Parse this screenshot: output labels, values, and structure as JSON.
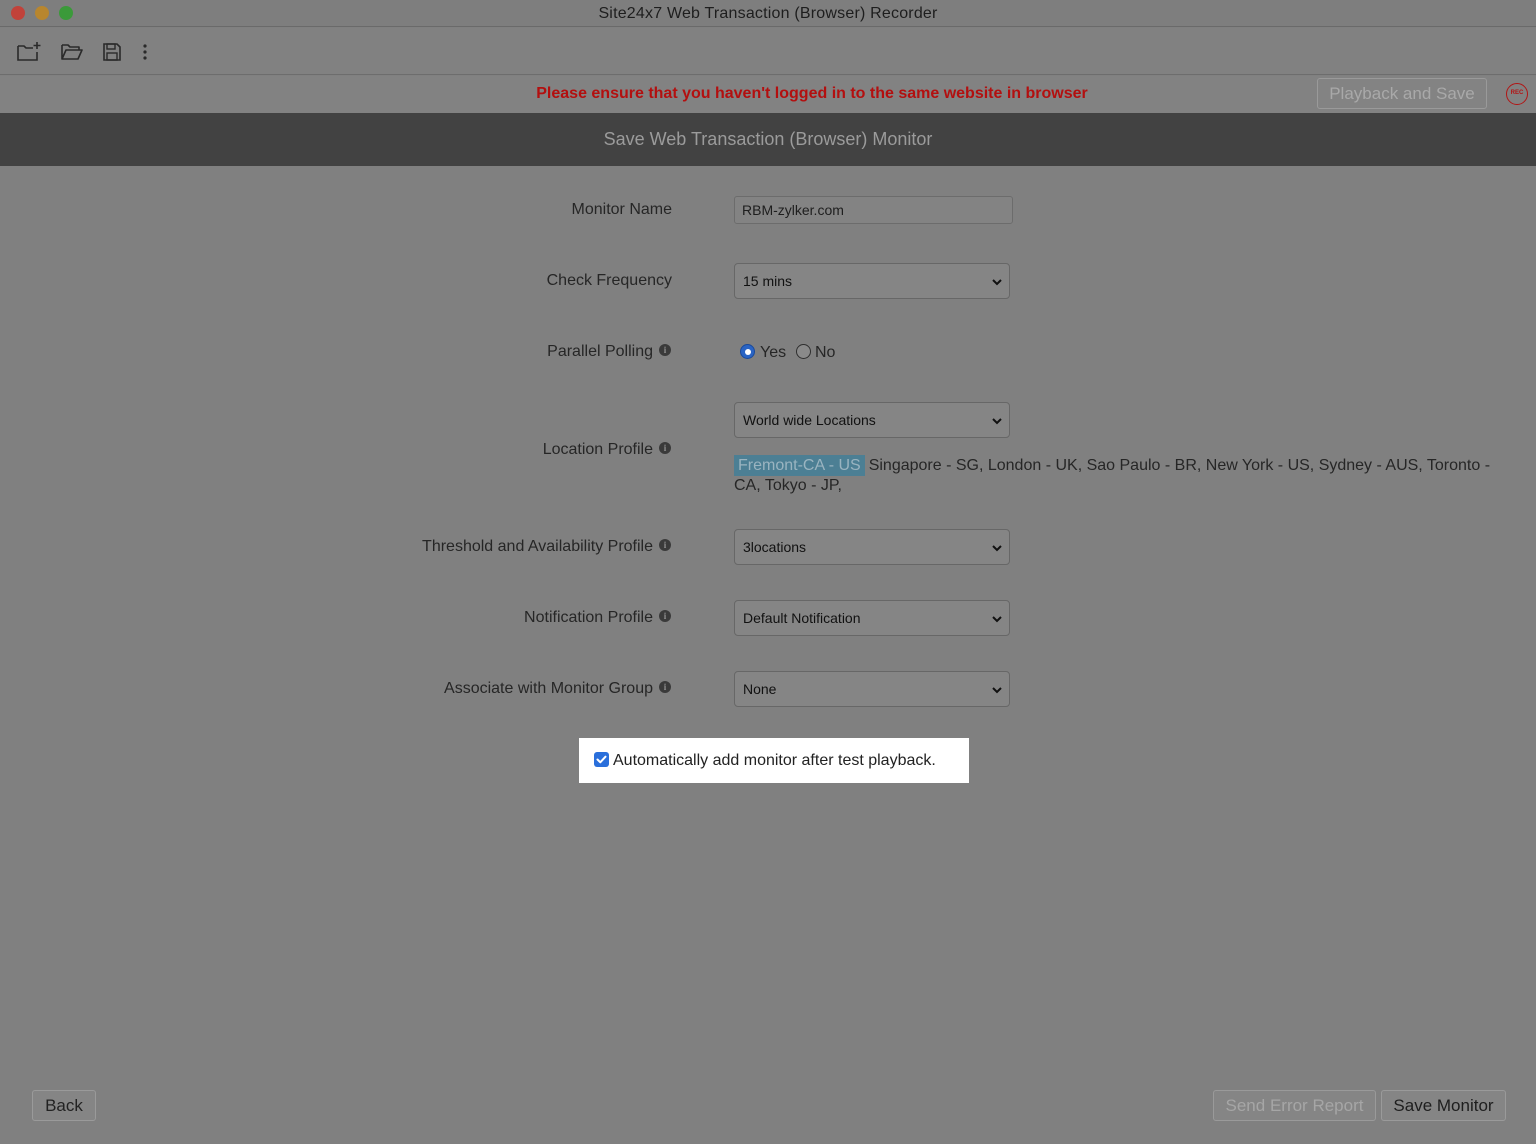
{
  "window": {
    "title": "Site24x7 Web Transaction (Browser) Recorder"
  },
  "toolbar": {
    "icons": [
      "new-folder-icon",
      "open-folder-icon",
      "save-icon",
      "more-vertical-icon"
    ]
  },
  "warning": {
    "text": "Please ensure that you haven't logged in to the same website in browser",
    "playback_label": "Playback and Save",
    "rec_label": "REC",
    "color": "#b30f0f"
  },
  "header": {
    "title": "Save Web Transaction (Browser) Monitor"
  },
  "form": {
    "monitor_name": {
      "label": "Monitor Name",
      "value": "RBM-zylker.com"
    },
    "check_frequency": {
      "label": "Check Frequency",
      "value": "15 mins"
    },
    "parallel_polling": {
      "label": "Parallel Polling",
      "yes": "Yes",
      "no": "No",
      "selected": "Yes"
    },
    "location_profile": {
      "label": "Location Profile",
      "value": "World wide Locations",
      "primary_location": "Fremont-CA - US",
      "other_locations": "Singapore - SG, London - UK, Sao Paulo - BR, New York - US, Sydney - AUS, Toronto - CA, Tokyo - JP,"
    },
    "threshold_profile": {
      "label": "Threshold and Availability Profile",
      "value": "3locations"
    },
    "notification_profile": {
      "label": "Notification Profile",
      "value": "Default Notification"
    },
    "monitor_group": {
      "label": "Associate with Monitor Group",
      "value": "None"
    },
    "auto_add": {
      "label": "Automatically add monitor after test playback.",
      "checked": true
    }
  },
  "footer": {
    "back_label": "Back",
    "error_label": "Send Error Report",
    "save_label": "Save Monitor"
  },
  "info_glyph": "i"
}
